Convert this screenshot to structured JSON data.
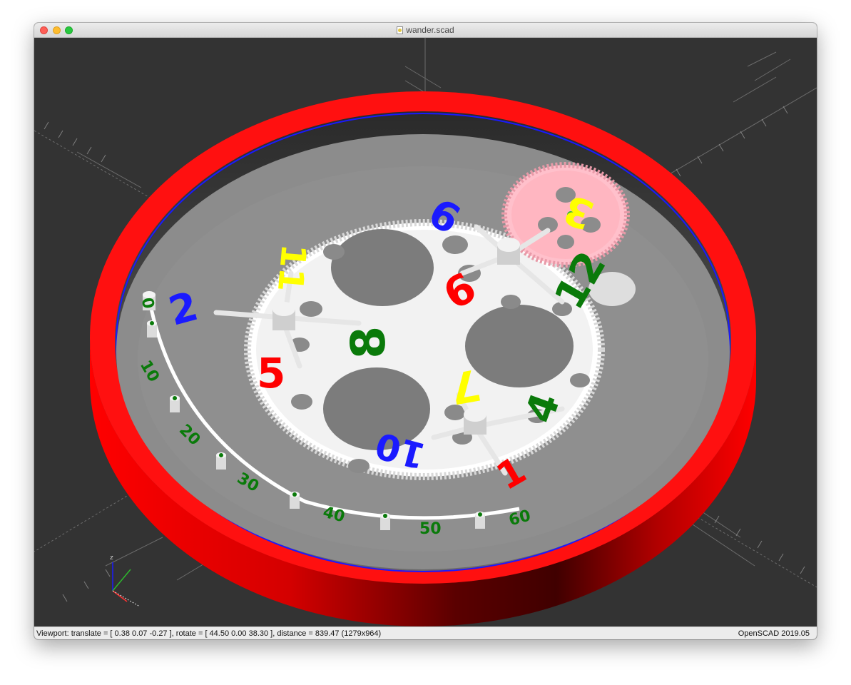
{
  "window": {
    "title": "wander.scad"
  },
  "viewport": {
    "axis_labels": [
      "x",
      "y",
      "z"
    ],
    "minute_scale": [
      "0",
      "10",
      "20",
      "30",
      "40",
      "50",
      "60"
    ],
    "small_axis_labels": [
      "z"
    ],
    "gear_numbers": {
      "n1": "1",
      "n2": "2",
      "n3": "3",
      "n4": "4",
      "n5": "5",
      "n6": "6",
      "n7": "7",
      "n8": "8",
      "n9": "9",
      "n10": "10",
      "n11": "11",
      "n12": "12"
    },
    "colors": {
      "background": "#333333",
      "case": "#ff0000",
      "floor": "#8c8c8c",
      "wheel": "#ffffff",
      "small_gear": "#ffb6c1",
      "green": "#0a7a0a",
      "blue": "#1a1aff",
      "yellow": "#ffff00",
      "red": "#ff0000"
    }
  },
  "status": {
    "left": "Viewport: translate = [ 0.38 0.07 -0.27 ], rotate = [ 44.50 0.00 38.30 ], distance = 839.47 (1279x964)",
    "right": "OpenSCAD 2019.05"
  }
}
